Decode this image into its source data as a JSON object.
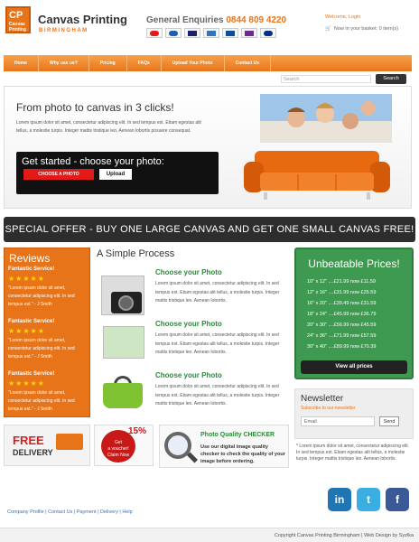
{
  "brand": {
    "logo": "CP",
    "logo_sub": "Canvas Printing",
    "name": "Canvas Printing",
    "city": "BIRMINGHAM"
  },
  "header": {
    "enquiries_label": "General Enquiries",
    "phone": "0844 809 4220",
    "payment_cards": [
      "mastercard",
      "maestro",
      "visa",
      "amex",
      "cirrus",
      "solo",
      "paypal"
    ],
    "welcome": "Welcome, Login",
    "basket": "Now in your basket: 0 item(s)"
  },
  "nav": {
    "items": [
      "Home",
      "Why use us?",
      "Pricing",
      "FAQs",
      "Upload Your Photo",
      "Contact Us"
    ]
  },
  "search": {
    "placeholder": "Search",
    "button": "Search"
  },
  "hero": {
    "title": "From photo to canvas in 3 clicks!",
    "text": "Lorem ipsum dolor sit amet, consectetur adipiscing elit. In sed tempus est. Etiam egestas alit tellus, a molestie turpis. Integer mattis tristique leo. Aenean lobortis posuere consequat.",
    "get_started": "Get started - choose your photo:",
    "choose_button": "CHOOSE A PHOTO",
    "upload_button": "Upload"
  },
  "offer": "SPECIAL OFFER - BUY ONE LARGE CANVAS AND GET ONE SMALL CANVAS FREE!",
  "reviews": {
    "title": "Reviews",
    "items": [
      {
        "heading": "Fantastic Service!",
        "stars": "★★★★★",
        "text": "\"Lorem ipsum dolor sit amet, consectetur adipiscing elit. In sed tempus est.\" - J Smith"
      },
      {
        "heading": "Fantastic Service!",
        "stars": "★★★★★",
        "text": "\"Lorem ipsum dolor sit amet, consectetur adipiscing elit. In sed tempus est.\" - J Smith"
      },
      {
        "heading": "Fantastic Service!",
        "stars": "★★★★★",
        "text": "\"Lorem ipsum dolor sit amet, consectetur adipiscing elit. In sed tempus est.\" - J Smith"
      }
    ]
  },
  "process": {
    "title": "A Simple Process",
    "steps": [
      {
        "title": "Choose your Photo",
        "text": "Lorem ipsum dolor sit amet, consectetur adipiscing elit. In sed tempus est. Etiam egestas alit tellus, a molestie turpis. Integer mattis tristique leo. Aenean lobortis."
      },
      {
        "title": "Choose your Photo",
        "text": "Lorem ipsum dolor sit amet, consectetur adipiscing elit. In sed tempus est. Etiam egestas alit tellus, a molestie turpis. Integer mattis tristique leo. Aenean lobortis."
      },
      {
        "title": "Choose your Photo",
        "text": "Lorem ipsum dolor sit amet, consectetur adipiscing elit. In sed tempus est. Etiam egestas alit tellus, a molestie turpis. Integer mattis tristique leo. Aenean lobortis."
      }
    ]
  },
  "prices": {
    "title": "Unbeatable Prices!",
    "rows": [
      "10\" x 12\" ....£21.99 now £11.59",
      "12\" x 16\" ....£31.99 now £25.59",
      "16\" x 20\" ....£39.49 now £31.59",
      "18\" x 24\" ....£45.99 now £36.79",
      "20\" x 30\" ....£56.99 now £45.59",
      "24\" x 36\" ....£71.99 now £57.59",
      "30\" x 40\" ....£89.99 now £70.39"
    ],
    "button": "View all prices"
  },
  "newsletter": {
    "title": "Newsletter",
    "subtitle": "Subscribe to our newsletter",
    "email_placeholder": "Email",
    "send": "Send",
    "text": "* Lorem ipsum dolor sit amet, consectetur adipiscing elit. In sed tempus est. Etiam egestas alit tellus, a molestie turpis. Integer mattis tristique leo. Aenean lobortis."
  },
  "promos": {
    "free": "FREE",
    "delivery": "DELIVERY",
    "voucher_line1": "Get",
    "voucher_line2": "a voucher!",
    "voucher_line3": "Claim Now",
    "voucher_badge": "15%",
    "quality_title": "Photo Quality CHECKER",
    "quality_text": "Use our digital image quality checker to check the quality of your image before ordering."
  },
  "footer": {
    "links": "Company Profile | Contact Us | Payment | Delivery | Help",
    "social": [
      "in",
      "t",
      "f"
    ],
    "copyright": "Copyright Canvas Printing Birmingham | Web Design by Syzlka"
  },
  "colors": {
    "orange": "#e8741a",
    "green": "#3e9a50",
    "dark": "#2d2d2d",
    "red": "#e31a1a"
  }
}
